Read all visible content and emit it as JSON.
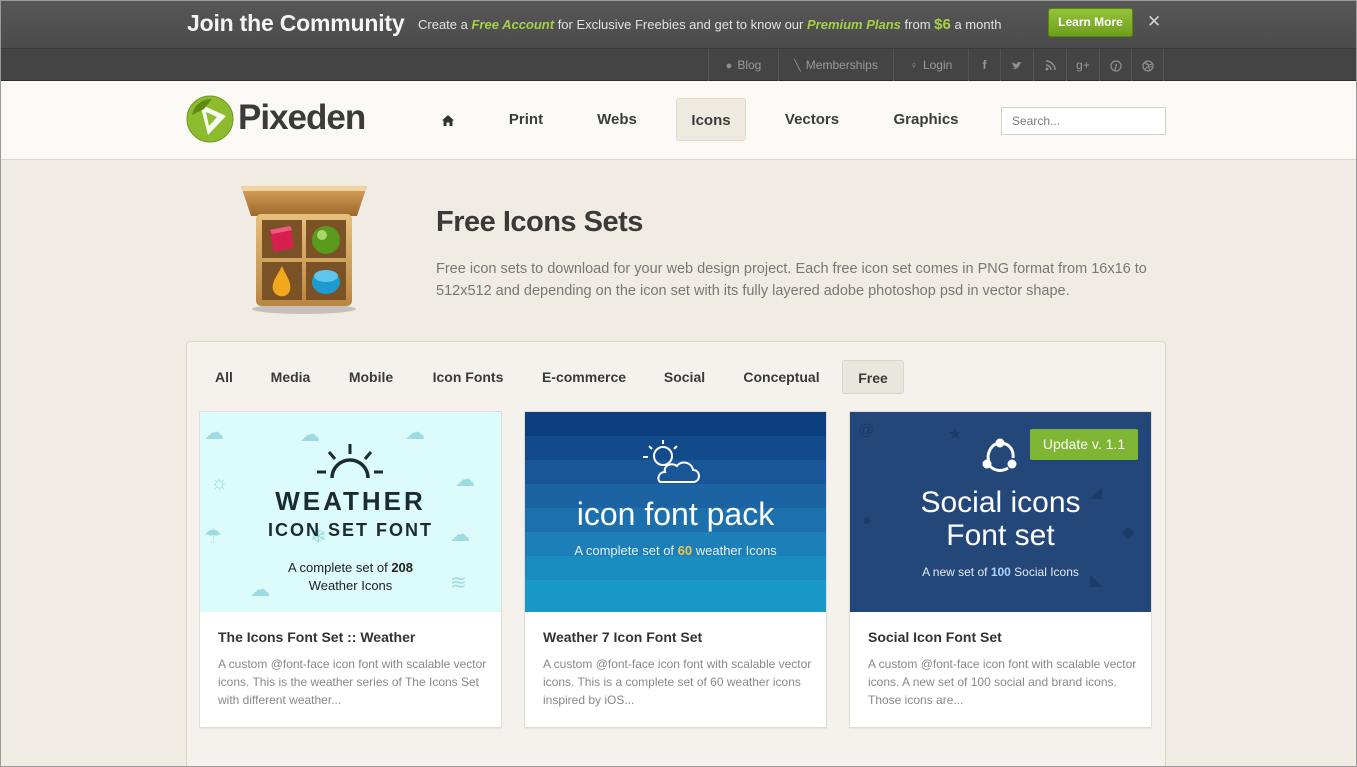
{
  "promo": {
    "title": "Join the Community",
    "text_before": "Create a ",
    "free_account": "Free Account",
    "text_middle": " for Exclusive Freebies and get to know our ",
    "premium_plans": "Premium Plans",
    "text_from": " from ",
    "price": "$6",
    "text_after": " a month",
    "learn_more": "Learn More",
    "close": "✕"
  },
  "utility": {
    "items": [
      {
        "label": "Blog",
        "icon": "speech-bubble-icon"
      },
      {
        "label": "Memberships",
        "icon": "pen-icon"
      },
      {
        "label": "Login",
        "icon": "key-icon"
      }
    ],
    "social": [
      "facebook-icon",
      "twitter-icon",
      "rss-icon",
      "google-plus-icon",
      "pinterest-icon",
      "dribbble-icon"
    ]
  },
  "header": {
    "logo_text": "Pixeden",
    "nav": [
      "Print",
      "Webs",
      "Icons",
      "Vectors",
      "Graphics"
    ],
    "active_nav": "Icons",
    "search_placeholder": "Search..."
  },
  "hero": {
    "title": "Free Icons Sets",
    "description": "Free icon sets to download for your web design project. Each free icon set comes in PNG format from 16x16 to 512x512 and depending on the icon set with its fully layered adobe photoshop psd in vector shape."
  },
  "filters": {
    "items": [
      "All",
      "Media",
      "Mobile",
      "Icon Fonts",
      "E-commerce",
      "Social",
      "Conceptual",
      "Free"
    ],
    "active": "Free"
  },
  "cards": [
    {
      "title": "The Icons Font Set :: Weather",
      "description": "A custom @font-face icon font with scalable vector icons. This is the weather series of The Icons Set with different weather...",
      "thumb": {
        "line1": "WEATHER",
        "line2": "ICON SET FONT",
        "sub_before": "A complete set of ",
        "sub_num": "208",
        "sub_line2": "Weather Icons"
      }
    },
    {
      "title": "Weather 7 Icon Font Set",
      "description": "A custom @font-face icon font with scalable vector icons. This is a complete set of 60 weather icons inspired by iOS...",
      "thumb": {
        "big": "icon font pack",
        "sub_before": "A complete set of ",
        "sub_num": "60",
        "sub_after": " weather Icons"
      }
    },
    {
      "title": "Social Icon Font Set",
      "description": "A custom @font-face icon font with scalable vector icons. A new set of 100 social and brand icons. Those icons are...",
      "thumb": {
        "badge": "Update v. 1.1",
        "line1": "Social icons",
        "line2": "Font set",
        "sub_before": "A new set of ",
        "sub_num": "100",
        "sub_after": " Social Icons"
      }
    }
  ],
  "colors": {
    "accent_green": "#7eb532",
    "promo_bg": "#575757",
    "page_bg": "#f1ece3"
  }
}
